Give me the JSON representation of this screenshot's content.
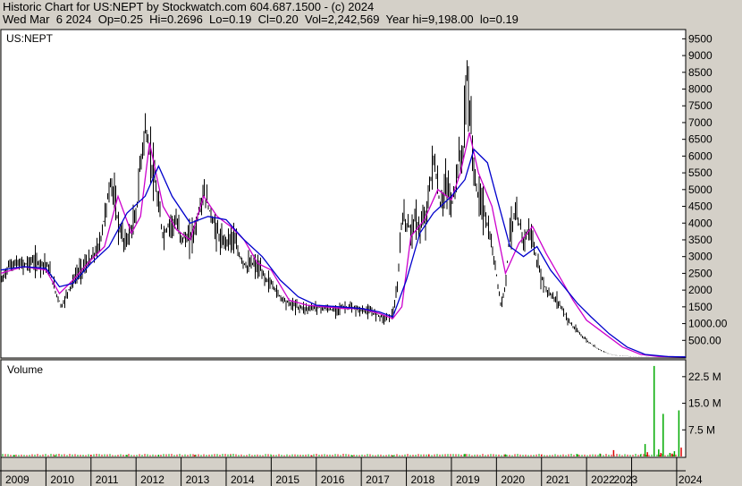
{
  "header": {
    "line1": "Historic Chart for US:NEPT by Stockwatch.com 604.687.1500 - (c) 2024",
    "line2": "Wed Mar  6 2024  Op=0.25  Hi=0.2696  Lo=0.19  Cl=0.20  Vol=2,242,569  Year hi=9,198.00  lo=0.19"
  },
  "colors": {
    "background": "#d4d0c8",
    "plot_bg": "#ffffff",
    "price_bars": "#000000",
    "ma_short": "#cc00cc",
    "ma_long": "#0000cc",
    "volume_up": "#00aa00",
    "volume_down": "#dd0000"
  },
  "chart_data": [
    {
      "type": "line",
      "panel": "price",
      "symbol_label": "US:NEPT",
      "y_tick_labels": [
        "9500",
        "9000",
        "8500",
        "8000",
        "7500",
        "7000",
        "6500",
        "6000",
        "5500",
        "5000",
        "4500",
        "4000",
        "3500",
        "3000",
        "2500",
        "2000",
        "1500",
        "1000.00",
        "500.00"
      ],
      "y_ticks": [
        9500,
        9000,
        8500,
        8000,
        7500,
        7000,
        6500,
        6000,
        5500,
        5000,
        4500,
        4000,
        3500,
        3000,
        2500,
        2000,
        1500,
        1000,
        500
      ],
      "ylim": [
        0,
        9750
      ],
      "x_tick_labels": [
        "2009",
        "2010",
        "2011",
        "2012",
        "2013",
        "2014",
        "2015",
        "2016",
        "2017",
        "2018",
        "2019",
        "2020",
        "2021",
        "2022",
        "2023",
        "2024"
      ],
      "x_ticks": [
        2009,
        2010,
        2011,
        2012,
        2013,
        2014,
        2015,
        2016,
        2017,
        2018,
        2019,
        2020,
        2021,
        2022,
        2023,
        2024
      ],
      "xlim": [
        2009.0,
        2024.2
      ],
      "series": [
        {
          "x": [
            2009.0,
            2009.15,
            2009.3,
            2009.5,
            2009.7,
            2009.85,
            2010.0,
            2010.1,
            2010.2,
            2010.35,
            2010.5,
            2010.7,
            2010.85,
            2011.0,
            2011.1,
            2011.2,
            2011.3,
            2011.45,
            2011.6,
            2011.75,
            2011.9,
            2012.0,
            2012.1,
            2012.2,
            2012.3,
            2012.45,
            2012.6,
            2012.75,
            2012.9,
            2013.0,
            2013.15,
            2013.3,
            2013.5,
            2013.65,
            2013.75,
            2013.9,
            2014.0,
            2014.15,
            2014.3,
            2014.45,
            2014.6,
            2014.75,
            2014.9,
            2015.0,
            2015.2,
            2015.4,
            2015.6,
            2015.8,
            2016.0,
            2016.2,
            2016.4,
            2016.6,
            2016.8,
            2017.0,
            2017.2,
            2017.4,
            2017.5,
            2017.6,
            2017.7,
            2017.8,
            2017.9,
            2018.0,
            2018.1,
            2018.2,
            2018.3,
            2018.45,
            2018.6,
            2018.75,
            2018.9,
            2019.0,
            2019.08,
            2019.15,
            2019.25,
            2019.35,
            2019.45,
            2019.55,
            2019.7,
            2019.85,
            2020.0,
            2020.1,
            2020.2,
            2020.3,
            2020.4,
            2020.5,
            2020.6,
            2020.75,
            2020.9,
            2021.0,
            2021.1,
            2021.25,
            2021.4,
            2021.55,
            2021.7,
            2021.85,
            2022.0,
            2022.2,
            2022.4,
            2022.6,
            2022.8,
            2023.0,
            2023.3,
            2023.6,
            2024.0,
            2024.2
          ],
          "y": [
            2200,
            2700,
            2800,
            2750,
            2850,
            2800,
            2800,
            2500,
            2000,
            1500,
            2000,
            2500,
            2700,
            2900,
            3100,
            3400,
            4200,
            5300,
            4000,
            3400,
            3800,
            4200,
            5800,
            6800,
            6200,
            4900,
            3600,
            4000,
            4000,
            3600,
            3500,
            3800,
            4900,
            4300,
            3900,
            3400,
            3500,
            3600,
            3000,
            2700,
            2800,
            2600,
            2300,
            2200,
            1800,
            1600,
            1500,
            1450,
            1500,
            1450,
            1400,
            1500,
            1450,
            1400,
            1350,
            1250,
            1150,
            1200,
            1300,
            2000,
            4200,
            4000,
            3800,
            4100,
            3800,
            4300,
            6000,
            4500,
            5200,
            4500,
            5000,
            5800,
            6000,
            8500,
            6500,
            5000,
            4500,
            3600,
            2500,
            1500,
            2200,
            3800,
            4200,
            4000,
            3500,
            3800,
            2800,
            2400,
            2000,
            1800,
            1600,
            1200,
            900,
            700,
            500,
            300,
            150,
            60,
            40,
            20,
            10,
            5,
            2,
            1
          ]
        },
        {
          "name": "",
          "x": [
            2009.0,
            2009.5,
            2010.0,
            2010.3,
            2010.6,
            2011.0,
            2011.3,
            2011.6,
            2011.9,
            2012.1,
            2012.3,
            2012.6,
            2012.9,
            2013.2,
            2013.5,
            2013.8,
            2014.1,
            2014.4,
            2014.7,
            2015.0,
            2015.4,
            2015.8,
            2016.2,
            2016.6,
            2017.0,
            2017.4,
            2017.7,
            2017.9,
            2018.1,
            2018.4,
            2018.7,
            2019.0,
            2019.2,
            2019.4,
            2019.6,
            2019.9,
            2020.2,
            2020.5,
            2020.8,
            2021.1,
            2021.4,
            2021.7,
            2022.0,
            2022.4,
            2022.8,
            2023.2,
            2023.6,
            2024.2
          ],
          "y": [
            2500,
            2700,
            2600,
            1900,
            2300,
            2900,
            3300,
            4800,
            3700,
            4200,
            6400,
            4500,
            3800,
            3500,
            4800,
            4200,
            3900,
            3500,
            2800,
            2600,
            1700,
            1550,
            1500,
            1450,
            1450,
            1300,
            1150,
            1500,
            3600,
            4100,
            5000,
            4700,
            5500,
            6700,
            5500,
            4500,
            2500,
            3400,
            3900,
            3100,
            2400,
            1700,
            1100,
            700,
            300,
            80,
            20,
            5
          ]
        },
        {
          "name": "",
          "x": [
            2009.0,
            2009.5,
            2010.0,
            2010.3,
            2010.6,
            2011.0,
            2011.4,
            2011.8,
            2012.2,
            2012.5,
            2012.8,
            2013.2,
            2013.6,
            2014.0,
            2014.4,
            2014.8,
            2015.2,
            2015.6,
            2016.0,
            2016.5,
            2017.0,
            2017.4,
            2017.7,
            2018.0,
            2018.3,
            2018.6,
            2019.0,
            2019.3,
            2019.5,
            2019.8,
            2020.0,
            2020.3,
            2020.6,
            2020.9,
            2021.2,
            2021.5,
            2021.8,
            2022.1,
            2022.5,
            2022.9,
            2023.3,
            2023.8,
            2024.2
          ],
          "y": [
            2600,
            2700,
            2650,
            2100,
            2200,
            2800,
            3300,
            4300,
            4800,
            5700,
            4800,
            4000,
            4200,
            4100,
            3500,
            3000,
            2300,
            1800,
            1550,
            1500,
            1450,
            1350,
            1200,
            2300,
            3700,
            4300,
            4800,
            5300,
            6200,
            5800,
            4800,
            3300,
            3000,
            3300,
            2600,
            2100,
            1600,
            1200,
            700,
            300,
            80,
            15,
            5
          ]
        }
      ]
    },
    {
      "type": "bar",
      "panel": "volume",
      "title": "Volume",
      "y_tick_labels": [
        "22.5 M",
        "15.0 M",
        "7.5 M"
      ],
      "y_ticks": [
        22.5,
        15.0,
        7.5
      ],
      "ylim": [
        0,
        27
      ],
      "x": [
        2009.3,
        2010.2,
        2011.0,
        2011.8,
        2012.5,
        2013.3,
        2014.1,
        2015.0,
        2015.9,
        2016.8,
        2017.7,
        2018.5,
        2019.3,
        2020.2,
        2021.0,
        2021.8,
        2022.3,
        2022.6,
        2023.2,
        2023.3,
        2023.35,
        2023.5,
        2023.6,
        2023.65,
        2023.7,
        2023.85,
        2023.9,
        2023.95,
        2024.05,
        2024.1
      ],
      "values": [
        0.4,
        0.3,
        0.5,
        0.4,
        0.5,
        0.4,
        0.3,
        0.3,
        0.3,
        0.3,
        0.3,
        0.6,
        0.7,
        0.6,
        0.5,
        0.6,
        0.8,
        1.8,
        0.5,
        3.5,
        1.2,
        25.5,
        2.0,
        1.0,
        12.0,
        1.0,
        0.8,
        1.5,
        13.0,
        2.5
      ]
    }
  ]
}
